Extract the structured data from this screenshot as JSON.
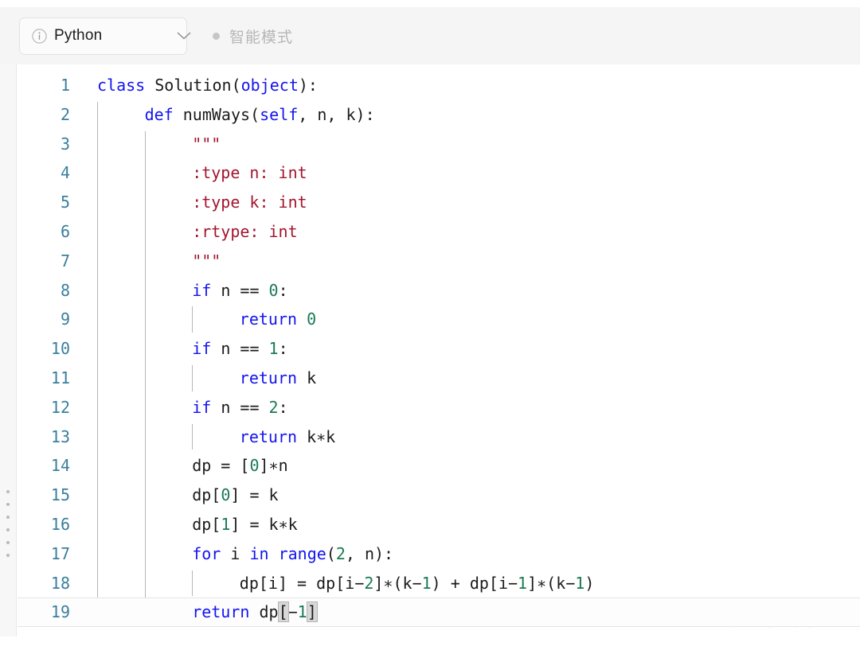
{
  "toolbar": {
    "language_selector": {
      "icon": "info-circle-icon",
      "label": "Python",
      "chevron": "chevron-down-icon"
    },
    "mode_indicator": {
      "dot": "status-dot-icon",
      "label": "智能模式"
    }
  },
  "editor": {
    "language": "Python",
    "current_line": 19,
    "gutter_handle": "resize-handle-icon",
    "colors": {
      "keyword": "#1414ef",
      "builtin": "#1414ef",
      "number": "#197a52",
      "string": "#a3152e",
      "plain": "#1b1b1b",
      "line_number": "#3a7f9c",
      "toolbar_bg": "#f5f5f6",
      "editor_bg": "#ffffff",
      "bracket_match": "#d8d8d8"
    },
    "lines": [
      {
        "n": "1",
        "indent": 0,
        "tokens": [
          {
            "t": "class",
            "c": "kw"
          },
          {
            "t": " ",
            "c": "op"
          },
          {
            "t": "Solution",
            "c": "name"
          },
          {
            "t": "(",
            "c": "punc"
          },
          {
            "t": "object",
            "c": "bi"
          },
          {
            "t": "):",
            "c": "punc"
          }
        ]
      },
      {
        "n": "2",
        "indent": 1,
        "tokens": [
          {
            "t": "def",
            "c": "kw"
          },
          {
            "t": " ",
            "c": "op"
          },
          {
            "t": "numWays",
            "c": "name"
          },
          {
            "t": "(",
            "c": "punc"
          },
          {
            "t": "self",
            "c": "bi"
          },
          {
            "t": ", n, k):",
            "c": "punc"
          }
        ]
      },
      {
        "n": "3",
        "indent": 2,
        "tokens": [
          {
            "t": "\"\"\"",
            "c": "str"
          }
        ]
      },
      {
        "n": "4",
        "indent": 2,
        "tokens": [
          {
            "t": ":type n: int",
            "c": "str"
          }
        ]
      },
      {
        "n": "5",
        "indent": 2,
        "tokens": [
          {
            "t": ":type k: int",
            "c": "str"
          }
        ]
      },
      {
        "n": "6",
        "indent": 2,
        "tokens": [
          {
            "t": ":rtype: int",
            "c": "str"
          }
        ]
      },
      {
        "n": "7",
        "indent": 2,
        "tokens": [
          {
            "t": "\"\"\"",
            "c": "str"
          }
        ]
      },
      {
        "n": "8",
        "indent": 2,
        "tokens": [
          {
            "t": "if",
            "c": "kw"
          },
          {
            "t": " n == ",
            "c": "op"
          },
          {
            "t": "0",
            "c": "num"
          },
          {
            "t": ":",
            "c": "punc"
          }
        ]
      },
      {
        "n": "9",
        "indent": 3,
        "tokens": [
          {
            "t": "return",
            "c": "kw"
          },
          {
            "t": " ",
            "c": "op"
          },
          {
            "t": "0",
            "c": "num"
          }
        ]
      },
      {
        "n": "10",
        "indent": 2,
        "tokens": [
          {
            "t": "if",
            "c": "kw"
          },
          {
            "t": " n == ",
            "c": "op"
          },
          {
            "t": "1",
            "c": "num"
          },
          {
            "t": ":",
            "c": "punc"
          }
        ]
      },
      {
        "n": "11",
        "indent": 3,
        "tokens": [
          {
            "t": "return",
            "c": "kw"
          },
          {
            "t": " k",
            "c": "op"
          }
        ]
      },
      {
        "n": "12",
        "indent": 2,
        "tokens": [
          {
            "t": "if",
            "c": "kw"
          },
          {
            "t": " n == ",
            "c": "op"
          },
          {
            "t": "2",
            "c": "num"
          },
          {
            "t": ":",
            "c": "punc"
          }
        ]
      },
      {
        "n": "13",
        "indent": 3,
        "tokens": [
          {
            "t": "return",
            "c": "kw"
          },
          {
            "t": " k∗k",
            "c": "op"
          }
        ]
      },
      {
        "n": "14",
        "indent": 2,
        "tokens": [
          {
            "t": "dp = [",
            "c": "op"
          },
          {
            "t": "0",
            "c": "num"
          },
          {
            "t": "]∗n",
            "c": "op"
          }
        ]
      },
      {
        "n": "15",
        "indent": 2,
        "tokens": [
          {
            "t": "dp[",
            "c": "op"
          },
          {
            "t": "0",
            "c": "num"
          },
          {
            "t": "] = k",
            "c": "op"
          }
        ]
      },
      {
        "n": "16",
        "indent": 2,
        "tokens": [
          {
            "t": "dp[",
            "c": "op"
          },
          {
            "t": "1",
            "c": "num"
          },
          {
            "t": "] = k∗k",
            "c": "op"
          }
        ]
      },
      {
        "n": "17",
        "indent": 2,
        "tokens": [
          {
            "t": "for",
            "c": "kw"
          },
          {
            "t": " i ",
            "c": "op"
          },
          {
            "t": "in",
            "c": "kw"
          },
          {
            "t": " ",
            "c": "op"
          },
          {
            "t": "range",
            "c": "bi"
          },
          {
            "t": "(",
            "c": "punc"
          },
          {
            "t": "2",
            "c": "num"
          },
          {
            "t": ", n):",
            "c": "punc"
          }
        ]
      },
      {
        "n": "18",
        "indent": 3,
        "tokens": [
          {
            "t": "dp[i] = dp[i−",
            "c": "op"
          },
          {
            "t": "2",
            "c": "num"
          },
          {
            "t": "]∗(k−",
            "c": "op"
          },
          {
            "t": "1",
            "c": "num"
          },
          {
            "t": ") + dp[i−",
            "c": "op"
          },
          {
            "t": "1",
            "c": "num"
          },
          {
            "t": "]∗(k−",
            "c": "op"
          },
          {
            "t": "1",
            "c": "num"
          },
          {
            "t": ")",
            "c": "op"
          }
        ]
      },
      {
        "n": "19",
        "indent": 2,
        "current": true,
        "tokens": [
          {
            "t": "return",
            "c": "kw"
          },
          {
            "t": " dp",
            "c": "op"
          },
          {
            "t": "[",
            "c": "op",
            "hl": true
          },
          {
            "t": "−",
            "c": "op"
          },
          {
            "t": "1",
            "c": "num"
          },
          {
            "t": "]",
            "c": "op",
            "hl": true
          }
        ]
      }
    ]
  },
  "watermark": {
    "icon": "wechat-bubble-icon",
    "text": "测试开发干货"
  }
}
